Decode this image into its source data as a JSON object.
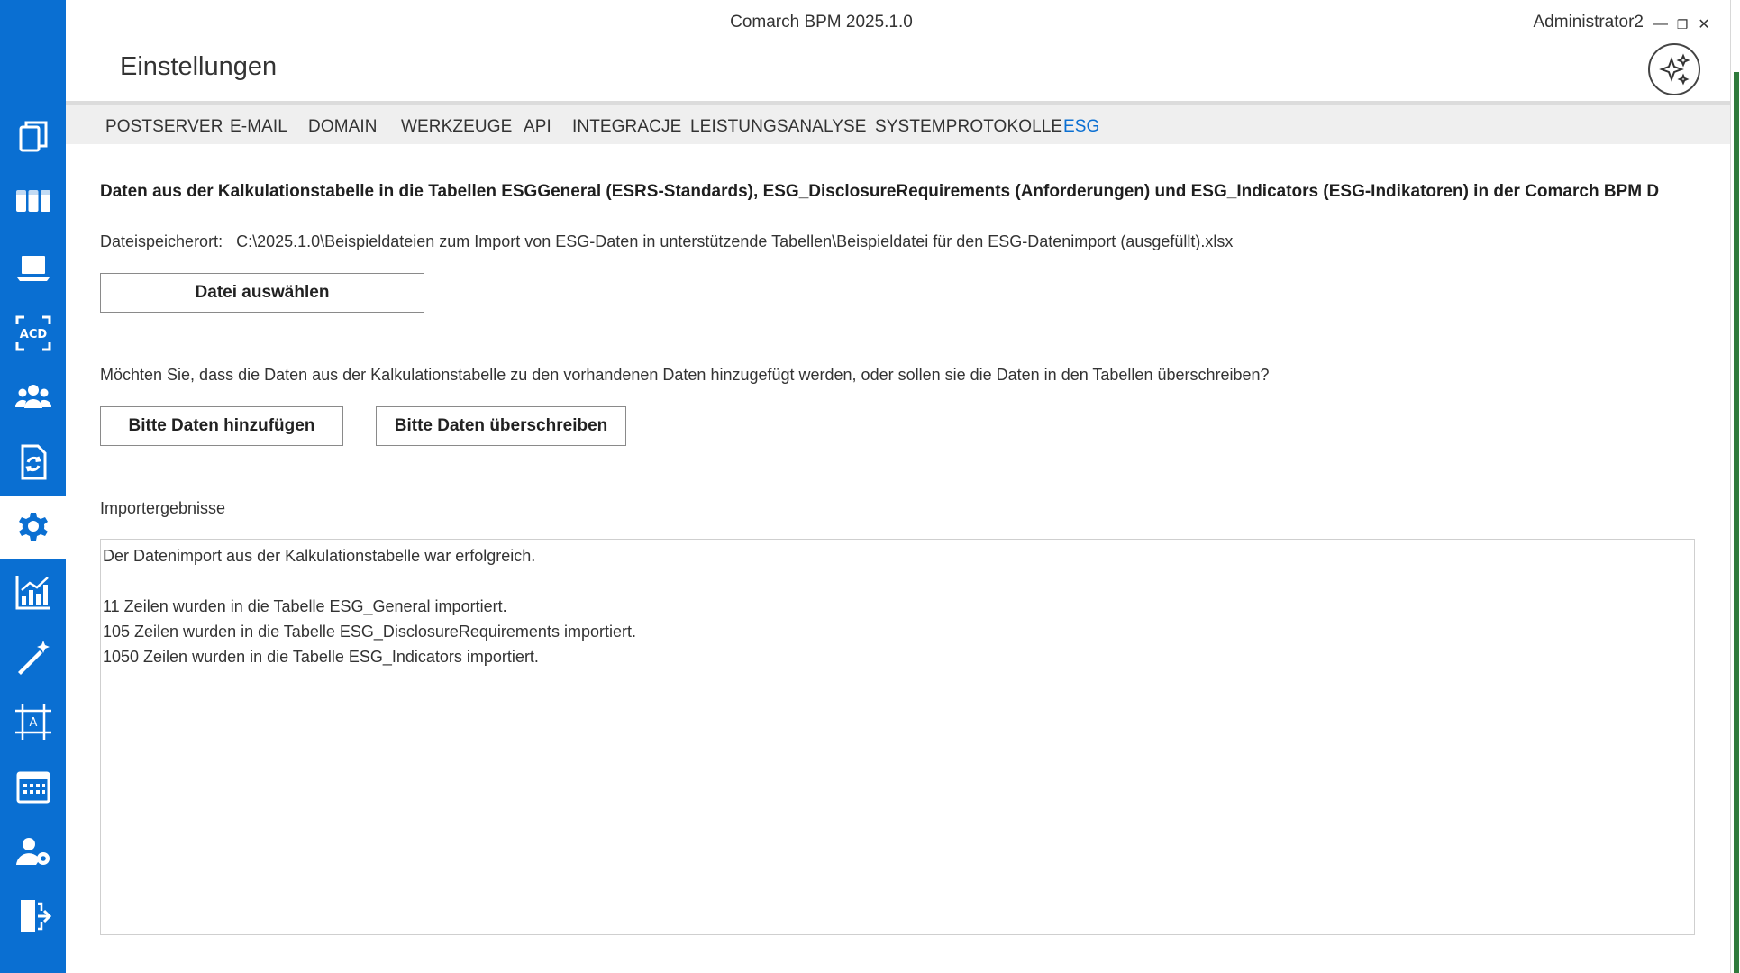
{
  "window": {
    "app_title": "Comarch BPM 2025.1.0",
    "user": "Administrator2",
    "minimize_glyph": "—",
    "restore_glyph": "❐",
    "close_glyph": "✕"
  },
  "page": {
    "title": "Einstellungen"
  },
  "sidebar": {
    "items": [
      {
        "icon": "documents-icon",
        "active": false
      },
      {
        "icon": "kanban-board-icon",
        "active": false
      },
      {
        "icon": "laptop-icon",
        "active": false
      },
      {
        "icon": "acd-scan-icon",
        "active": false
      },
      {
        "icon": "users-group-icon",
        "active": false
      },
      {
        "icon": "document-sync-icon",
        "active": false
      },
      {
        "icon": "gear-icon",
        "active": true
      },
      {
        "icon": "chart-icon",
        "active": false
      },
      {
        "icon": "magic-wand-icon",
        "active": false
      },
      {
        "icon": "design-frame-icon",
        "active": false
      },
      {
        "icon": "calendar-icon",
        "active": false
      },
      {
        "icon": "user-settings-icon",
        "active": false
      },
      {
        "icon": "exit-door-icon",
        "active": false
      }
    ]
  },
  "tabs": [
    {
      "label": "POSTSERVER",
      "active": false
    },
    {
      "label": "E-MAIL",
      "active": false
    },
    {
      "label": "DOMAIN",
      "active": false
    },
    {
      "label": "WERKZEUGE",
      "active": false
    },
    {
      "label": "API",
      "active": false
    },
    {
      "label": "INTEGRACJE",
      "active": false
    },
    {
      "label": "LEISTUNGSANALYSE",
      "active": false
    },
    {
      "label": "SYSTEMPROTOKOLLE",
      "active": false
    },
    {
      "label": "ESG",
      "active": true
    }
  ],
  "esg": {
    "heading": "Daten aus der Kalkulationstabelle in die Tabellen ESGGeneral (ESRS-Standards), ESG_DisclosureRequirements (Anforderungen) und ESG_Indicators (ESG-Indikatoren) in der Comarch BPM D",
    "file_location_label": "Dateispeicherort:",
    "file_location_value": "C:\\2025.1.0\\Beispieldateien zum Import von ESG-Daten in unterstützende Tabellen\\Beispieldatei für den ESG-Datenimport (ausgefüllt).xlsx",
    "choose_file_button": "Datei auswählen",
    "question": "Möchten Sie, dass die Daten aus der Kalkulationstabelle zu den vorhandenen Daten hinzugefügt werden, oder sollen sie die Daten in den Tabellen überschreiben?",
    "add_button": "Bitte Daten hinzufügen",
    "overwrite_button": "Bitte Daten überschreiben",
    "results_label": "Importergebnisse",
    "results_lines": [
      "Der Datenimport aus der Kalkulationstabelle war erfolgreich.",
      "",
      "11 Zeilen wurden in die Tabelle ESG_General importiert.",
      "105 Zeilen wurden in die Tabelle ESG_DisclosureRequirements importiert.",
      "1050 Zeilen wurden in die Tabelle ESG_Indicators importiert."
    ]
  },
  "colors": {
    "sidebar": "#0a6fd2",
    "active_tab": "#0a6fd2",
    "tabbar_bg": "#efefef"
  }
}
